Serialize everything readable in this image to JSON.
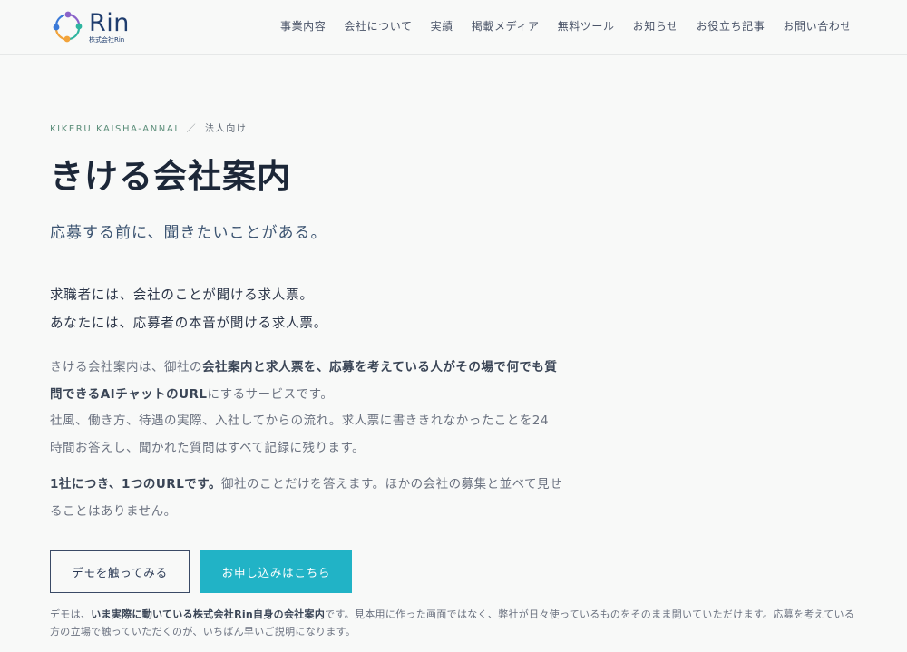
{
  "brand": {
    "name": "Rin",
    "sub": "株式会社Rin",
    "colors": [
      "#8a63c9",
      "#2fb5a0",
      "#f2a33a",
      "#3b7ad8"
    ]
  },
  "nav": {
    "items": [
      {
        "label": "事業内容"
      },
      {
        "label": "会社について"
      },
      {
        "label": "実績"
      },
      {
        "label": "掲載メディア"
      },
      {
        "label": "無料ツール"
      },
      {
        "label": "お知らせ"
      },
      {
        "label": "お役立ち記事"
      },
      {
        "label": "お問い合わせ"
      }
    ]
  },
  "hero": {
    "breadcrumb_en": "KIKERU KAISHA-ANNAI",
    "breadcrumb_sep": "／",
    "breadcrumb_ja": "法人向け",
    "title": "きける会社案内",
    "tagline": "応募する前に、聞きたいことがある。",
    "lead": [
      "求職者には、会社のことが聞ける求人票。",
      "あなたには、応募者の本音が聞ける求人票。"
    ]
  },
  "body1": {
    "part1": "きける会社案内は、御社の",
    "strong": "会社案内と求人票を、応募を考えている人がその場で何でも質問できるAIチャットのURL",
    "part2": "にするサービスです。",
    "part3": "社風、働き方、待遇の実際、入社してからの流れ。求人票に書ききれなかったことを24時間お答えし、聞かれた質問はすべて記録に残ります。"
  },
  "body2": {
    "strong": "1社につき、1つのURLです。",
    "rest": "御社のことだけを答えます。ほかの会社の募集と並べて見せることはありません。"
  },
  "buttons": {
    "demo_label": "デモを触ってみる",
    "apply_label": "お申し込みはこちら",
    "apply_color": "#21b3c6"
  },
  "note": {
    "part1": "デモは、",
    "strong": "いま実際に動いている株式会社Rin自身の会社案内",
    "part2": "です。見本用に作った画面ではなく、弊社が日々使っているものをそのまま開いていただけます。応募を考えている方の立場で触っていただくのが、いちばん早いご説明になります。"
  }
}
